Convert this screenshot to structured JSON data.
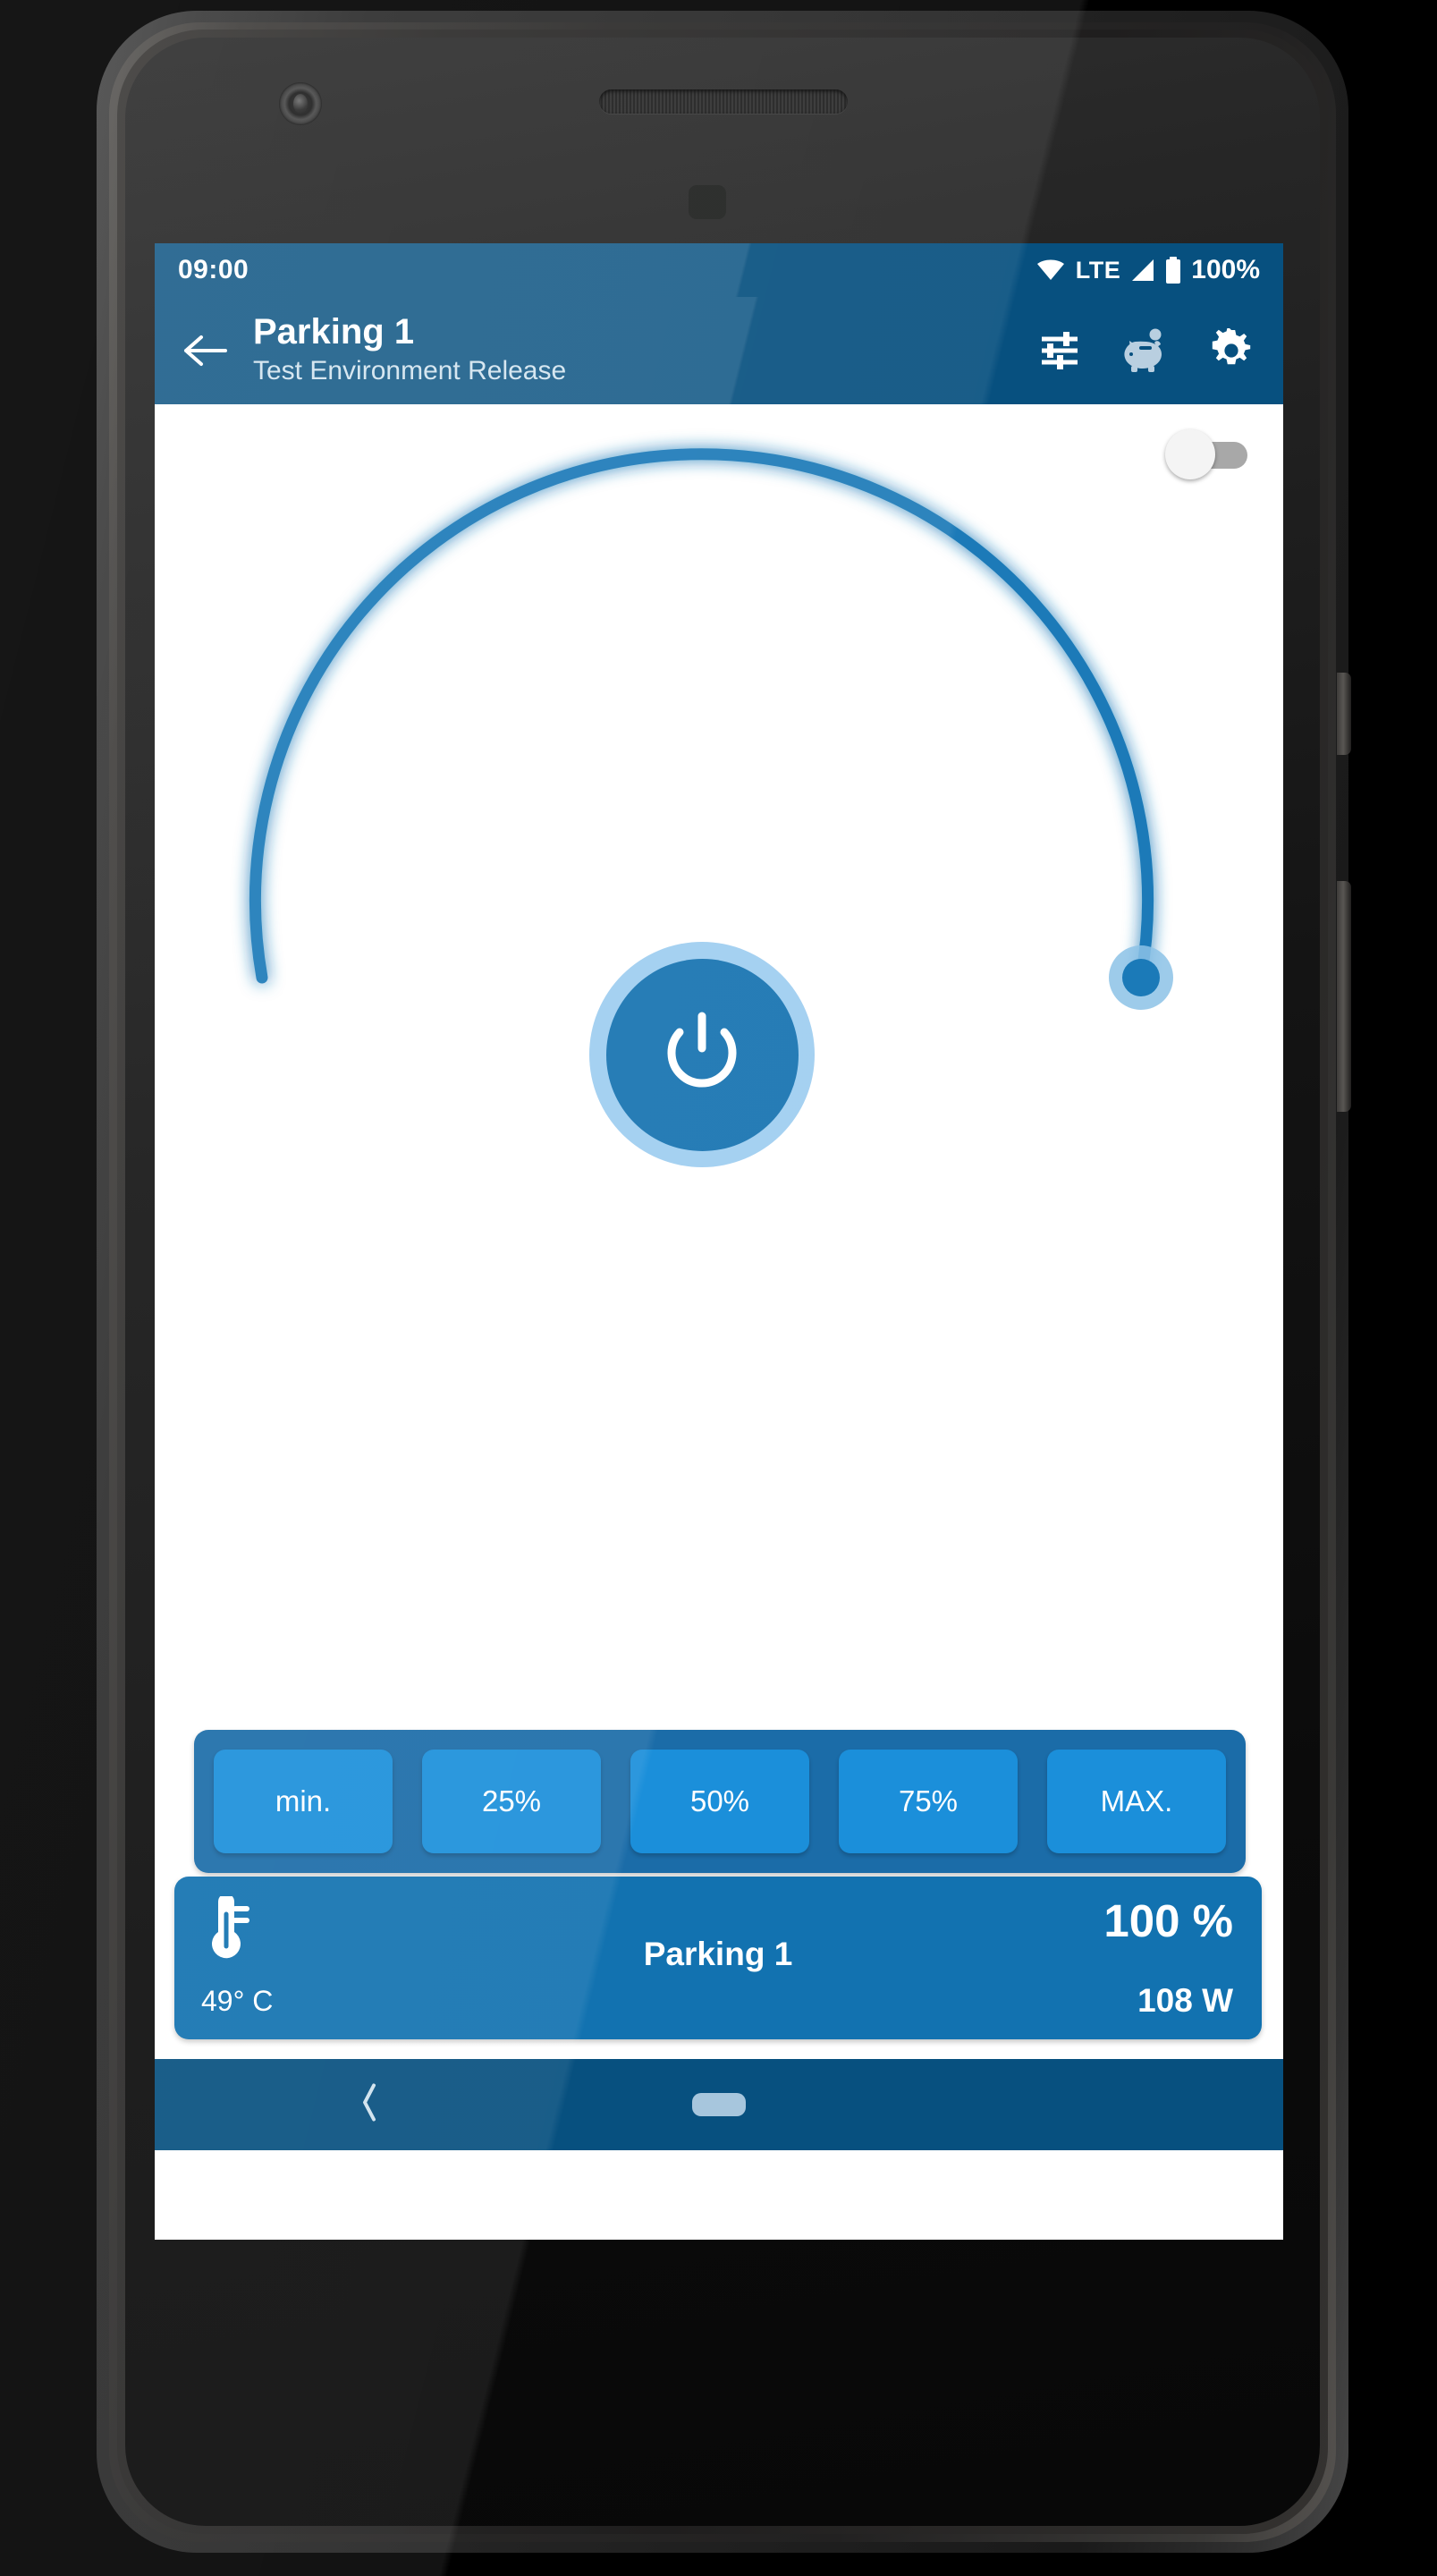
{
  "device": {
    "frame": "android-phone",
    "hardware": {
      "front_camera": "camera-icon",
      "earpiece": "speaker-grille",
      "proximity_sensor": "sensor",
      "power_button": "power-side-button",
      "volume_button": "volume-side-button"
    }
  },
  "status_bar": {
    "time": "09:00",
    "network_label": "LTE",
    "battery_percent": "100%",
    "icons": [
      "wifi-icon",
      "signal-icon",
      "battery-icon"
    ],
    "background": "#07507f"
  },
  "app_bar": {
    "back_label": "back-arrow",
    "title": "Parking 1",
    "subtitle": "Test Environment Release",
    "actions": [
      {
        "name": "tune-icon",
        "label": "Tune"
      },
      {
        "name": "piggy-bank-icon",
        "label": "Savings"
      },
      {
        "name": "gear-icon",
        "label": "Settings"
      }
    ],
    "background": "#07507f"
  },
  "main": {
    "master_toggle": {
      "name": "master-toggle",
      "state": "off",
      "track_color": "#a8a8a8",
      "knob_color": "#f4f4f4"
    },
    "gauge": {
      "value_percent": 100,
      "arc_color": "#1b7ab8",
      "thumb_color": "#1b7ab8",
      "thumb_halo_color": "#8cc2e6",
      "sweep_degrees": 270
    },
    "power_button": {
      "name": "power-button",
      "icon": "power-icon",
      "fill": "#1572b0",
      "ring": "#9ecdf0"
    },
    "presets": {
      "container_color": "#1b6ca8",
      "button_color": "#1b8fda",
      "items": [
        {
          "label": "min."
        },
        {
          "label": "25%"
        },
        {
          "label": "50%"
        },
        {
          "label": "75%"
        },
        {
          "label": "MAX."
        }
      ]
    },
    "info_bar": {
      "background": "#1272b0",
      "thermometer_icon": "thermometer-icon",
      "temperature": "49° C",
      "device_name": "Parking 1",
      "percent": "100 %",
      "power": "108 W"
    }
  },
  "nav_bar": {
    "background": "#07507f",
    "back_icon": "chevron-left-icon",
    "home_pill": "home-pill"
  }
}
